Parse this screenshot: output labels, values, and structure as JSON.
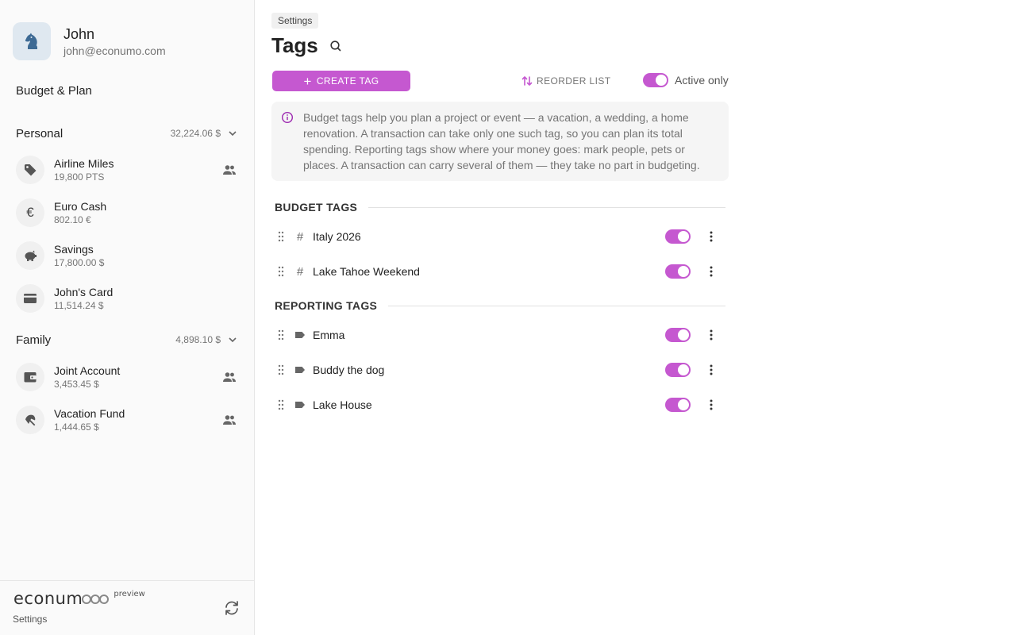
{
  "user": {
    "name": "John",
    "email": "john@econumo.com"
  },
  "sidebar": {
    "budget_link": "Budget & Plan",
    "groups": [
      {
        "name": "Personal",
        "total": "32,224.06 $",
        "accounts": [
          {
            "name": "Airline Miles",
            "balance": "19,800 PTS",
            "icon": "tag-icon",
            "shared": true
          },
          {
            "name": "Euro Cash",
            "balance": "802.10 €",
            "icon": "euro-icon",
            "shared": false
          },
          {
            "name": "Savings",
            "balance": "17,800.00 $",
            "icon": "piggy-bank-icon",
            "shared": false
          },
          {
            "name": "John's Card",
            "balance": "11,514.24 $",
            "icon": "credit-card-icon",
            "shared": false
          }
        ]
      },
      {
        "name": "Family",
        "total": "4,898.10 $",
        "accounts": [
          {
            "name": "Joint Account",
            "balance": "3,453.45 $",
            "icon": "wallet-icon",
            "shared": true
          },
          {
            "name": "Vacation Fund",
            "balance": "1,444.65 $",
            "icon": "beach-umbrella-icon",
            "shared": true
          }
        ]
      }
    ],
    "footer": {
      "logo": "econum",
      "preview": "preview",
      "settings": "Settings"
    }
  },
  "main": {
    "breadcrumb": "Settings",
    "title": "Tags",
    "create_label": "CREATE TAG",
    "reorder_label": "REORDER LIST",
    "active_only_label": "Active only",
    "active_only": true,
    "info": "Budget tags help you plan a project or event — a vacation, a wedding, a home renovation. A transaction can take only one such tag, so you can plan its total spending. Reporting tags show where your money goes: mark people, pets or places. A transaction can carry several of them — they take no part in budgeting.",
    "sections": [
      {
        "title": "BUDGET TAGS",
        "icon": "hash-icon",
        "tags": [
          {
            "name": "Italy 2026",
            "active": true
          },
          {
            "name": "Lake Tahoe Weekend",
            "active": true
          }
        ]
      },
      {
        "title": "REPORTING TAGS",
        "icon": "label-icon",
        "tags": [
          {
            "name": "Emma",
            "active": true
          },
          {
            "name": "Buddy the dog",
            "active": true
          },
          {
            "name": "Lake House",
            "active": true
          }
        ]
      }
    ]
  },
  "colors": {
    "accent": "#c558d0",
    "muted_text": "#757575",
    "info_bg": "#f5f5f5",
    "sidebar_bg": "#fafafa"
  }
}
